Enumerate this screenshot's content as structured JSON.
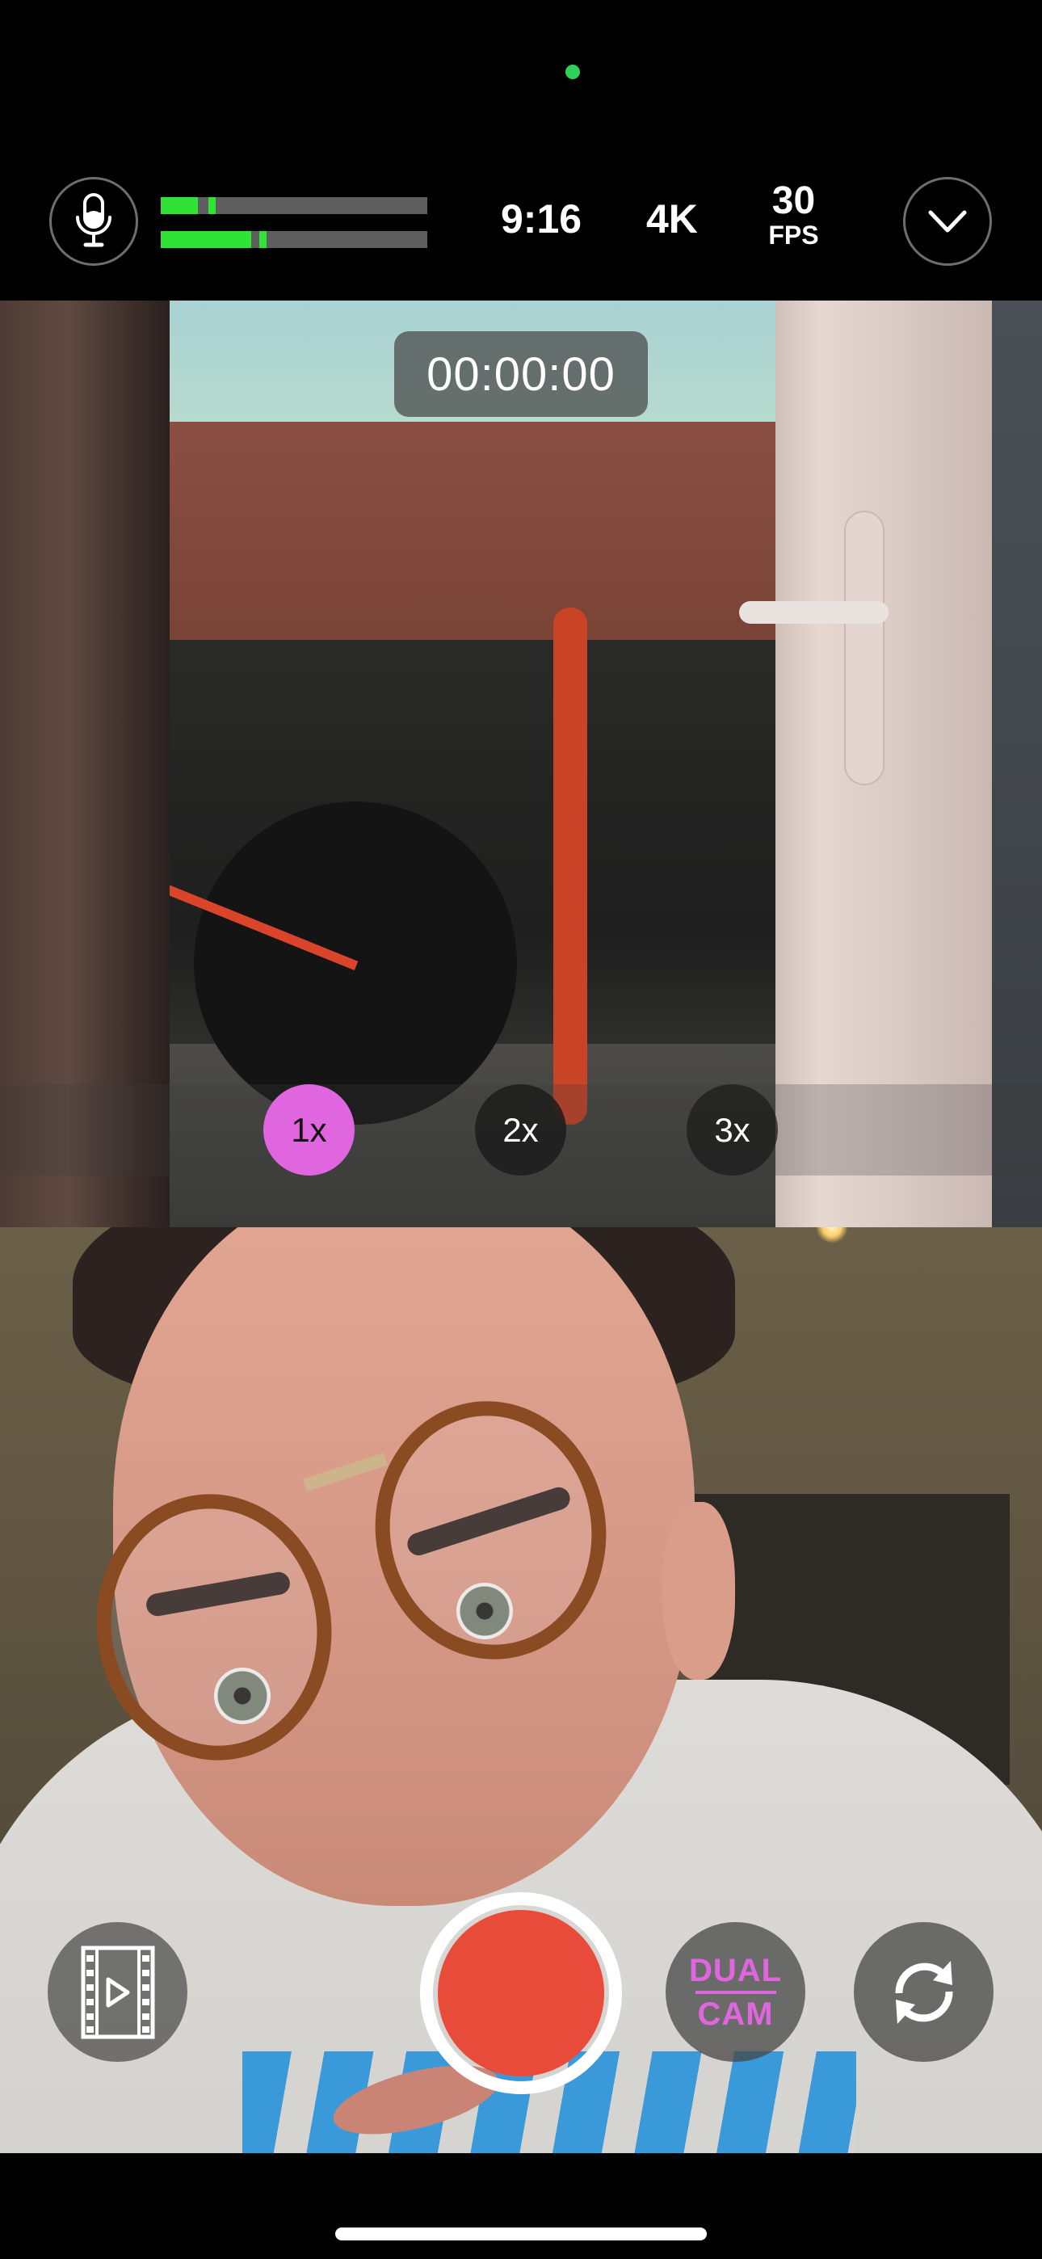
{
  "status": {
    "privacy_indicator": "camera-in-use-indicator",
    "privacy_indicator_color": "#30d158"
  },
  "toolbar": {
    "mic_icon": "microphone-icon",
    "audio_meters": [
      {
        "channel": "left",
        "level_percent": 14,
        "peak_percent": 18
      },
      {
        "channel": "right",
        "level_percent": 34,
        "peak_percent": 37
      }
    ],
    "meter_color": "#31e236",
    "aspect_ratio": "9:16",
    "resolution": "4K",
    "fps_value": "30",
    "fps_unit": "FPS",
    "expand_icon": "chevron-down-icon"
  },
  "back_camera": {
    "timer": "00:00:00",
    "zoom_options": [
      {
        "label": "1x",
        "selected": true
      },
      {
        "label": "2x",
        "selected": false
      },
      {
        "label": "3x",
        "selected": false
      }
    ],
    "accent_color": "#e066e0"
  },
  "front_camera": {
    "description": "selfie preview"
  },
  "controls": {
    "gallery_icon": "film-play-icon",
    "record_color": "#e94b3a",
    "dual_cam_line1": "DUAL",
    "dual_cam_line2": "CAM",
    "flip_icon": "camera-flip-icon"
  }
}
